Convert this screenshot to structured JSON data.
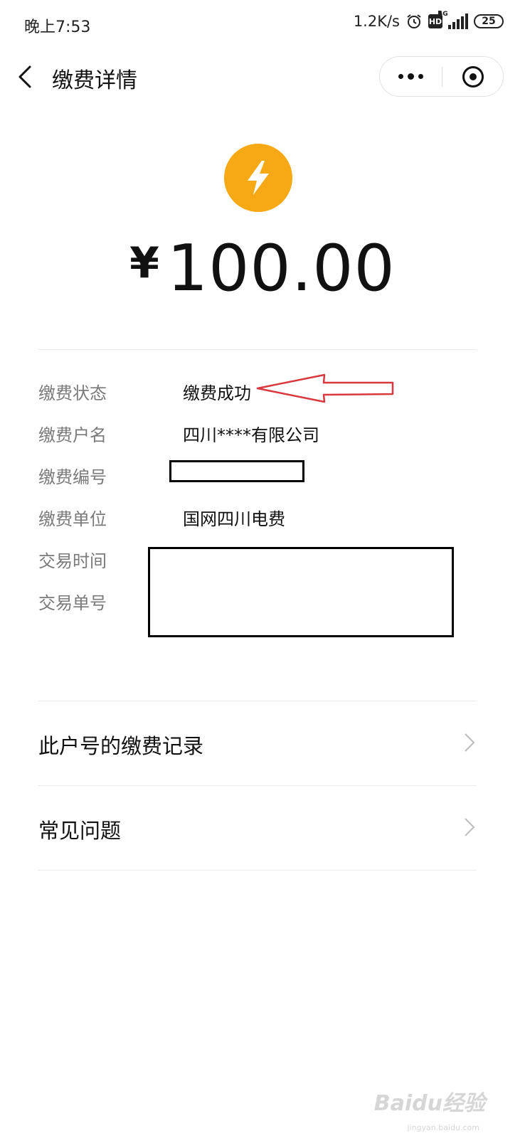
{
  "status_bar": {
    "time": "晚上7:53",
    "network_speed": "1.2K/s",
    "hd_label": "HD",
    "signal_label": "4G",
    "battery": "25"
  },
  "nav": {
    "title": "缴费详情"
  },
  "payment": {
    "icon": "lightning-bolt-icon",
    "icon_color": "#f6a914",
    "currency": "¥",
    "amount": "100.00"
  },
  "details": [
    {
      "label": "缴费状态",
      "value": "缴费成功"
    },
    {
      "label": "缴费户名",
      "value": "四川****有限公司"
    },
    {
      "label": "缴费编号",
      "value": ""
    },
    {
      "label": "缴费单位",
      "value": "国网四川电费"
    },
    {
      "label": "交易时间",
      "value": ""
    },
    {
      "label": "交易单号",
      "value": ""
    }
  ],
  "links": [
    {
      "label": "此户号的缴费记录"
    },
    {
      "label": "常见问题"
    }
  ],
  "annotation_color": "#d9383e",
  "watermark": {
    "text": "Baidu经验",
    "sub": "jingyan.baidu.com"
  }
}
